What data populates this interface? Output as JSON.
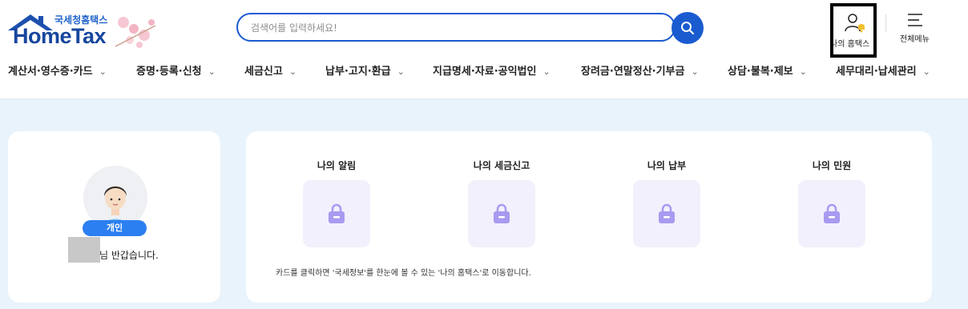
{
  "header": {
    "logo_sub": "국세청홈택스",
    "logo_main": "HomeTax",
    "search_placeholder": "검색어를 입력하세요!",
    "my_hometax_label": "나의 홈택스",
    "all_menu_label": "전체메뉴"
  },
  "nav": {
    "items": [
      "계산서·영수증·카드",
      "증명·등록·신청",
      "세금신고",
      "납부·고지·환급",
      "지급명세·자료·공익법인",
      "장려금·연말정산·기부금",
      "상담·불복·제보",
      "세무대리·납세관리"
    ]
  },
  "profile": {
    "badge": "개인",
    "greeting": "님 반갑습니다."
  },
  "summary": {
    "tiles": [
      "나의 알림",
      "나의 세금신고",
      "나의 납부",
      "나의 민원"
    ],
    "note": "카드를 클릭하면 '국세정보'를 한눈에 볼 수 있는 '나의 홈택스'로 이동합니다."
  },
  "colors": {
    "brand_blue": "#1a5bd0",
    "content_bg": "#e8f3fc",
    "tile_bg": "#f1f0fc",
    "lock_purple": "#a89af0",
    "badge_blue": "#2b7ff0"
  }
}
